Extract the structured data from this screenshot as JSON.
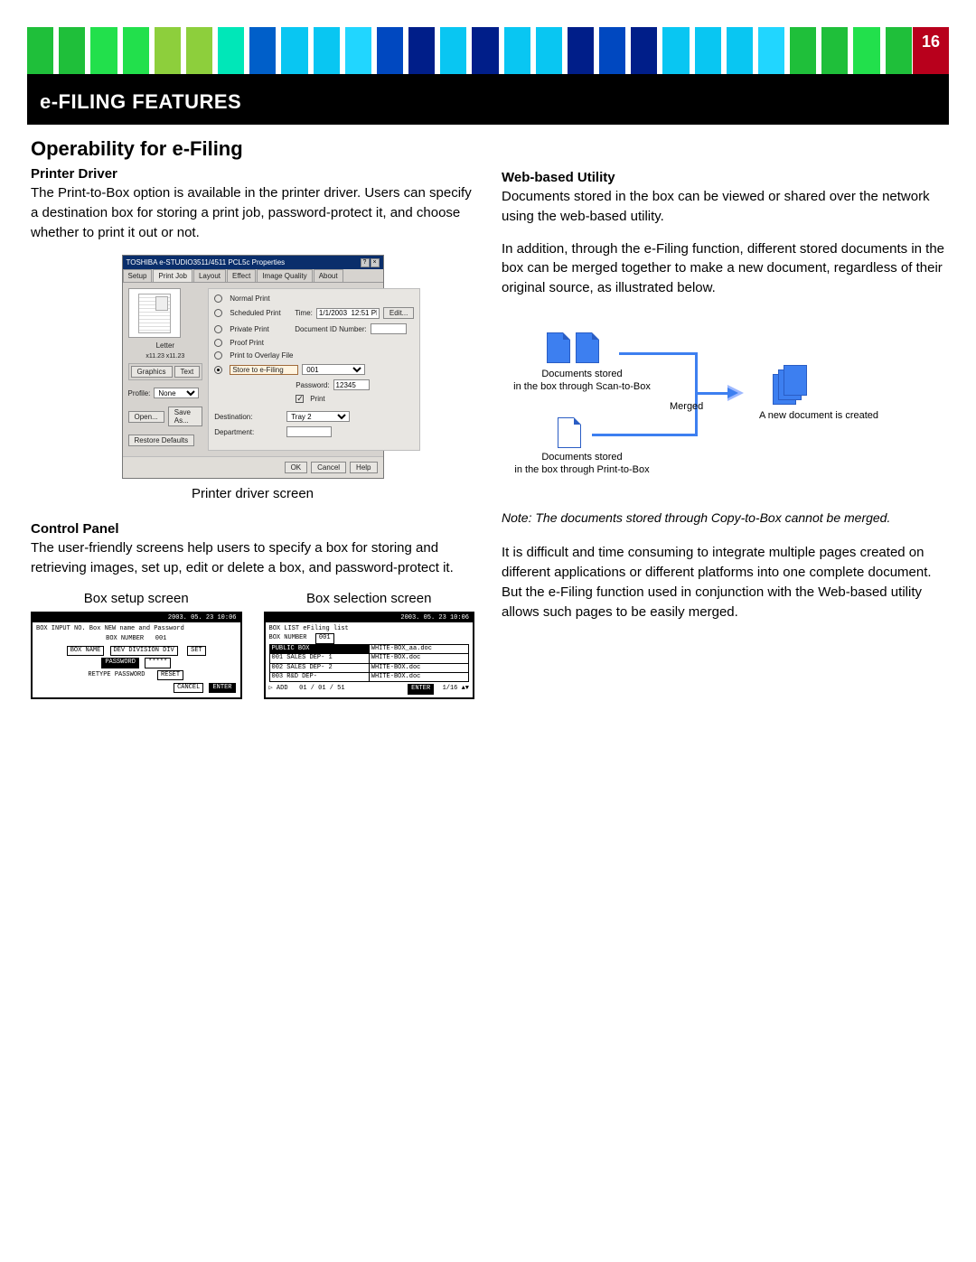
{
  "page_number": "16",
  "header_bar_colors": [
    "#1fbf3a",
    "#1fbf3a",
    "#22e04c",
    "#22e04c",
    "#8dcf3c",
    "#8dcf3c",
    "#00e7b8",
    "#005fc9",
    "#09c6f2",
    "#09c6f2",
    "#21d6ff",
    "#0048c0",
    "#001e89",
    "#09c6f2",
    "#001e89",
    "#09c6f2",
    "#09c6f2",
    "#001e89",
    "#0048c0",
    "#001e89",
    "#09c6f2",
    "#09c6f2",
    "#09c6f2",
    "#21d6ff",
    "#1fbf3a",
    "#1fbf3a",
    "#22e04c",
    "#1fbf3a",
    "#001e89"
  ],
  "title_band": "e-FILING FEATURES",
  "section_title": "Operability for e-Filing",
  "left": {
    "printer_driver_head": "Printer Driver",
    "printer_driver_text": "The Print-to-Box option is available in the printer driver. Users can specify a destination box for storing a print job, password-protect it, and choose whether to print it out or not.",
    "dialog": {
      "title": "TOSHIBA e-STUDIO3511/4511 PCL5c Properties",
      "tabs": [
        "Setup",
        "Print Job",
        "Layout",
        "Effect",
        "Image Quality",
        "About"
      ],
      "active_tab_index": 1,
      "radios": {
        "normal": "Normal Print",
        "scheduled": "Scheduled Print",
        "private": "Private Print",
        "proof": "Proof Print",
        "overlay": "Print to Overlay File",
        "store": "Store to e-Filing"
      },
      "time_label": "Time:",
      "time_value": "1/1/2003  12:51 PM",
      "time_button": "Edit...",
      "doc_id_label": "Document ID Number:",
      "letter_label": "Letter",
      "scale_label": "x11.23     x11.23",
      "graphics_btn": "Graphics",
      "text_btn": "Text",
      "profile_label": "Profile:",
      "profile_value": "None",
      "open_btn": "Open...",
      "saveas_btn": "Save As...",
      "restore_btn": "Restore Defaults",
      "destination_label": "Destination:",
      "destination_value": "001",
      "password_label": "Password:",
      "password_value": "12345",
      "print_check": "Print",
      "tray_label": "Destination:",
      "tray_value": "Tray 2",
      "department_label": "Department:",
      "ok": "OK",
      "cancel": "Cancel",
      "help": "Help"
    },
    "dialog_caption": "Printer driver screen",
    "control_panel_head": "Control Panel",
    "control_panel_text": "The user-friendly screens help users to specify a box for storing and retrieving images, set up, edit or delete a box, and password-protect it.",
    "lcd_caption_left": "Box setup screen",
    "lcd_caption_right": "Box selection screen",
    "lcd_left": {
      "clock": "2003. 05. 23  10:06",
      "line1": "BOX INPUT  NO. Box NEW name and Password",
      "line2_label": "BOX NUMBER",
      "line2_val": "001",
      "line3_a": "BOX NAME",
      "line3_b": "DEV DIVISION DIV",
      "line3_btn": "SET",
      "line4_a": "PASSWORD",
      "line4_b": "*****",
      "line5": "RETYPE PASSWORD",
      "line5_btn": "RESET",
      "btn_cancel": "CANCEL",
      "btn_enter": "ENTER"
    },
    "lcd_right": {
      "clock": "2003. 05. 23  10:06",
      "line1": "BOX LIST   eFiling list",
      "line2_a": "BOX NUMBER",
      "line2_b": "001",
      "rows": [
        [
          "PUBLIC BOX",
          "WHITE-BOX_aa.doc"
        ],
        [
          "001 SALES  DEP- 1",
          "WHITE-BOX.doc"
        ],
        [
          "002 SALES  DEP- 2",
          "WHITE-BOX.doc"
        ],
        [
          "003 R&D   DEP-",
          "WHITE-BOX.doc"
        ]
      ],
      "footer_left": "ADD",
      "footer_nums": "01 / 01 / 51",
      "enter": "ENTER",
      "page": "1/16"
    }
  },
  "right": {
    "web_head": "Web-based Utility",
    "web_p1": "Documents stored in the box can be viewed or shared over the network using the web-based utility.",
    "web_p2": "In addition, through the e-Filing function, different stored documents in the box can be merged together to make a new document, regardless of their original source, as illustrated below.",
    "diagram": {
      "scan_label": "Documents stored\nin the box through Scan-to-Box",
      "print_label": "Documents stored\nin the box through Print-to-Box",
      "merged": "Merged",
      "new_doc": "A new document is created"
    },
    "note": "Note: The documents stored through Copy-to-Box cannot be merged.",
    "web_p3": "It is difficult and time consuming to integrate multiple pages created on different applications or different platforms into one complete document. But the e-Filing function used in conjunction with the Web-based utility allows such pages to be easily merged."
  }
}
